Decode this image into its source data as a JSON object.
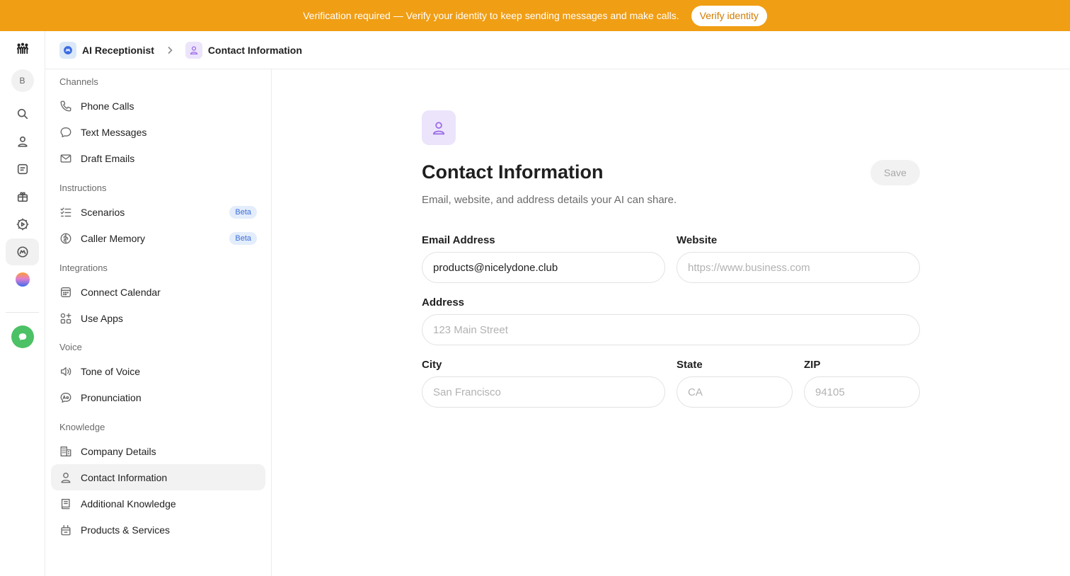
{
  "banner": {
    "text": "Verification required — Verify your identity to keep sending messages and make calls.",
    "button_label": "Verify identity",
    "color": "#f09e14"
  },
  "rail": {
    "avatar_letter": "B",
    "icons": [
      "logo-icon",
      "search-icon",
      "user-icon",
      "notes-icon",
      "gift-icon",
      "settings-play-icon",
      "ai-receptionist-icon",
      "gradient-orb-icon",
      "chat-icon"
    ]
  },
  "header": {
    "crumb_1": "AI Receptionist",
    "crumb_2": "Contact Information"
  },
  "nav": {
    "sections": {
      "channels": "Channels",
      "instructions": "Instructions",
      "integrations": "Integrations",
      "voice": "Voice",
      "knowledge": "Knowledge"
    },
    "items": {
      "phone_calls": "Phone Calls",
      "text_messages": "Text Messages",
      "draft_emails": "Draft Emails",
      "scenarios": "Scenarios",
      "caller_memory": "Caller Memory",
      "connect_calendar": "Connect Calendar",
      "use_apps": "Use Apps",
      "tone_of_voice": "Tone of Voice",
      "pronunciation": "Pronunciation",
      "company_details": "Company Details",
      "contact_information": "Contact Information",
      "additional_knowledge": "Additional Knowledge",
      "products_services": "Products & Services"
    },
    "beta_label": "Beta"
  },
  "main": {
    "title": "Contact Information",
    "subtitle": "Email, website, and address details your AI can share.",
    "save_label": "Save",
    "email": {
      "label": "Email Address",
      "value": "products@nicelydone.club",
      "placeholder": ""
    },
    "website": {
      "label": "Website",
      "value": "",
      "placeholder": "https://www.business.com"
    },
    "address": {
      "label": "Address",
      "value": "",
      "placeholder": "123 Main Street"
    },
    "city": {
      "label": "City",
      "value": "",
      "placeholder": "San Francisco"
    },
    "state": {
      "label": "State",
      "value": "",
      "placeholder": "CA"
    },
    "zip": {
      "label": "ZIP",
      "value": "",
      "placeholder": "94105"
    }
  },
  "colors": {
    "accent_purple": "#9a6ae8",
    "beta_blue": "#3e6fd8",
    "chat_green": "#4cc165"
  }
}
